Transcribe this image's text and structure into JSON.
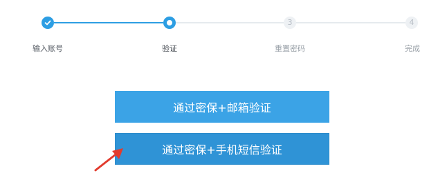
{
  "stepper": {
    "steps": [
      {
        "label": "输入账号",
        "state": "done",
        "number": ""
      },
      {
        "label": "验证",
        "state": "current",
        "number": ""
      },
      {
        "label": "重置密码",
        "state": "pending",
        "number": "3"
      },
      {
        "label": "完成",
        "state": "pending",
        "number": "4"
      }
    ],
    "colors": {
      "active": "#2d9ee3",
      "pending_line": "#e6eaee",
      "pending_circle": "#eef1f4"
    }
  },
  "options": {
    "email_label": "通过密保+邮箱验证",
    "sms_label": "通过密保+手机短信验证"
  },
  "annotation": {
    "color": "#e23b2e",
    "icon": "red-arrow-icon"
  }
}
